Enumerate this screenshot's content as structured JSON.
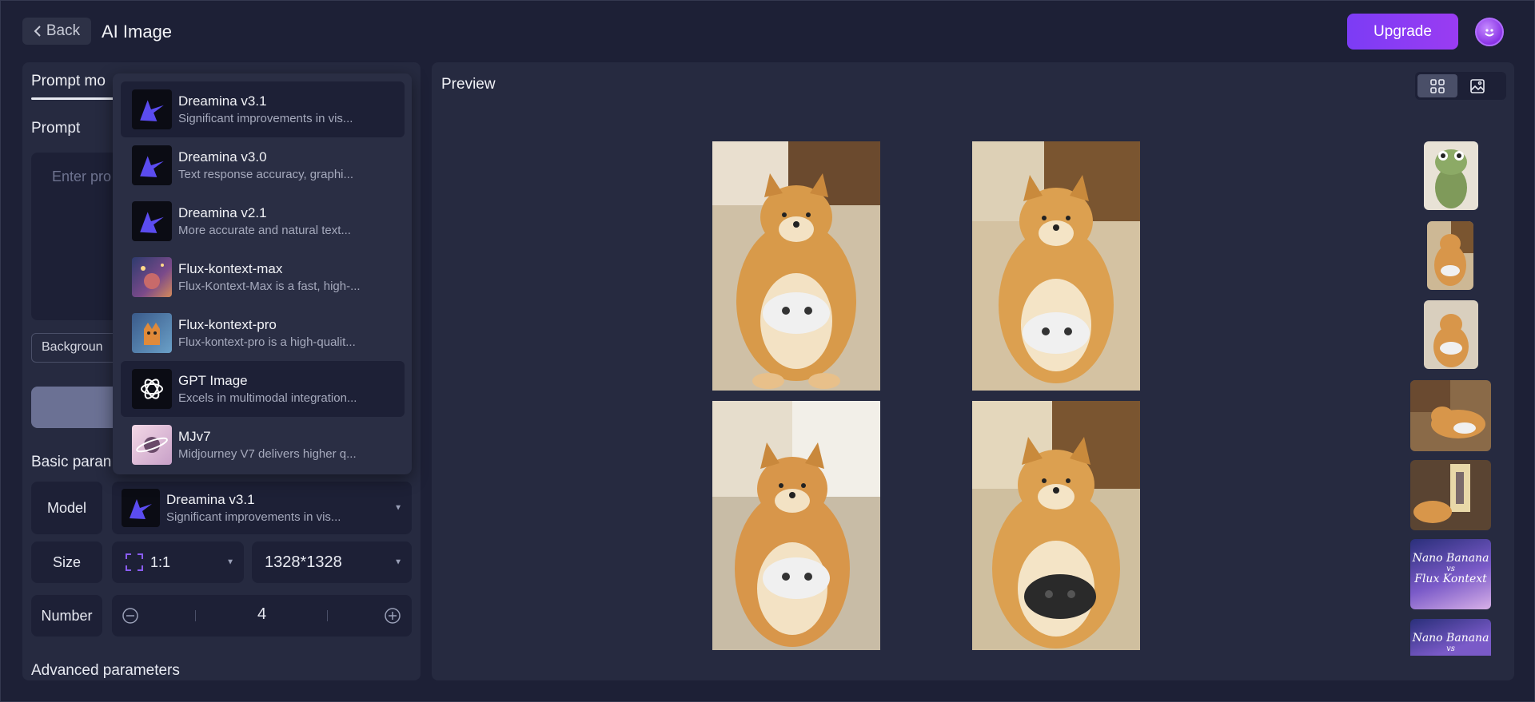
{
  "header": {
    "back_label": "Back",
    "title": "AI Image",
    "upgrade_label": "Upgrade"
  },
  "left": {
    "tab_label": "Prompt mo",
    "prompt_label": "Prompt",
    "prompt_placeholder": "Enter pro",
    "background_chip": "Backgroun",
    "basic_params_label": "Basic paran",
    "advanced_params_label": "Advanced parameters",
    "model": {
      "key": "Model",
      "name": "Dreamina v3.1",
      "desc": "Significant improvements in vis..."
    },
    "size": {
      "key": "Size",
      "ratio": "1:1",
      "resolution": "1328*1328"
    },
    "number": {
      "key": "Number",
      "value": "4"
    }
  },
  "dropdown": {
    "items": [
      {
        "name": "Dreamina v3.1",
        "desc": "Significant improvements in vis...",
        "icon": "dreamina-logo-icon"
      },
      {
        "name": "Dreamina v3.0",
        "desc": "Text response accuracy, graphi...",
        "icon": "dreamina-logo-icon"
      },
      {
        "name": "Dreamina v2.1",
        "desc": "More accurate and natural text...",
        "icon": "dreamina-logo-icon"
      },
      {
        "name": "Flux-kontext-max",
        "desc": "Flux-Kontext-Max is a fast, high-...",
        "icon": "flux-max-thumbnail"
      },
      {
        "name": "Flux-kontext-pro",
        "desc": "Flux-kontext-pro is a high-qualit...",
        "icon": "flux-pro-thumbnail"
      },
      {
        "name": "GPT Image",
        "desc": "Excels in multimodal integration...",
        "icon": "openai-logo-icon"
      },
      {
        "name": "MJv7",
        "desc": "Midjourney V7 delivers higher q...",
        "icon": "mj-planet-thumbnail"
      }
    ]
  },
  "preview": {
    "title": "Preview",
    "thumb_texts": [
      "Nano Banana",
      "vs",
      "Flux Kontext",
      "Nano Banana",
      "vs"
    ]
  },
  "colors": {
    "background": "#1d2036",
    "panel": "#262a40",
    "accent": "#7c3cf5",
    "dreamina_blue": "#5b4cf0"
  }
}
